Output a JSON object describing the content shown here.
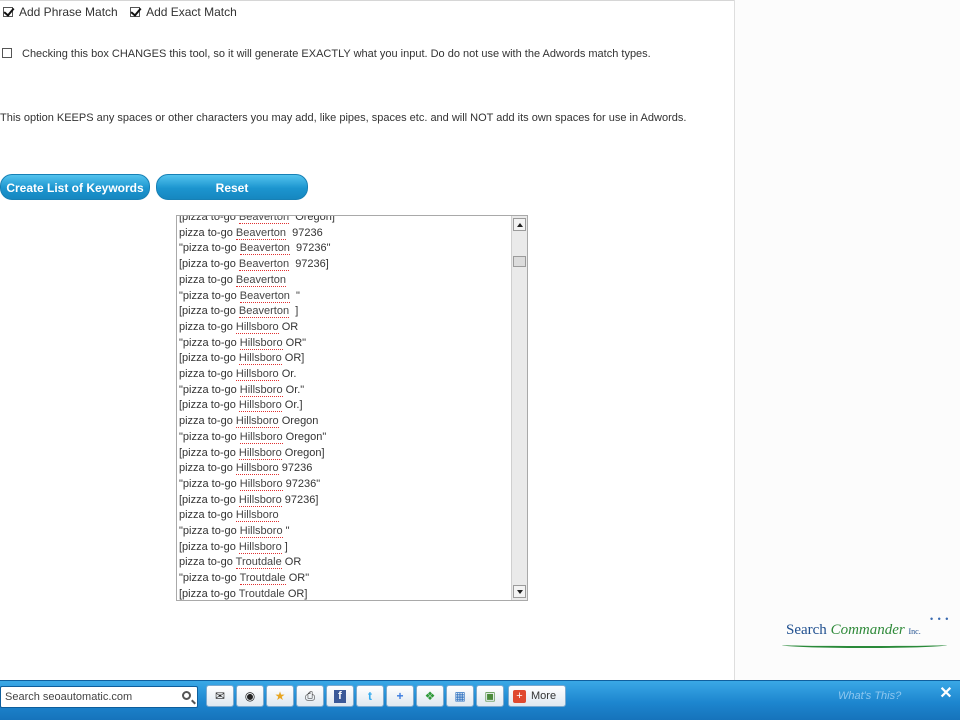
{
  "options": {
    "phrase_label": "Add Phrase Match",
    "phrase_checked": true,
    "exact_label": "Add Exact Match",
    "exact_checked": true
  },
  "exact_option": {
    "checked": false,
    "text": "Checking this box CHANGES this tool, so it will generate EXACTLY what you input. Do do not use with the Adwords match types."
  },
  "keeps_note": "This option KEEPS any spaces or other characters you may add, like pipes, spaces etc. and will NOT add its own spaces for use in Adwords.",
  "buttons": {
    "create": "Create List of Keywords",
    "reset": "Reset"
  },
  "keyword_list": [
    {
      "pre": "[pizza to-go ",
      "kw": "Beaverton",
      "post": "  Oregon]"
    },
    {
      "pre": "pizza to-go ",
      "kw": "Beaverton",
      "post": "  97236"
    },
    {
      "pre": "\"pizza to-go ",
      "kw": "Beaverton",
      "post": "  97236\""
    },
    {
      "pre": "[pizza to-go ",
      "kw": "Beaverton",
      "post": "  97236]"
    },
    {
      "pre": "pizza to-go ",
      "kw": "Beaverton",
      "post": ""
    },
    {
      "pre": "\"pizza to-go ",
      "kw": "Beaverton",
      "post": "  \""
    },
    {
      "pre": "[pizza to-go ",
      "kw": "Beaverton",
      "post": "  ]"
    },
    {
      "pre": "pizza to-go ",
      "kw": "Hillsboro",
      "post": " OR"
    },
    {
      "pre": "\"pizza to-go ",
      "kw": "Hillsboro",
      "post": " OR\""
    },
    {
      "pre": "[pizza to-go ",
      "kw": "Hillsboro",
      "post": " OR]"
    },
    {
      "pre": "pizza to-go ",
      "kw": "Hillsboro",
      "post": " Or."
    },
    {
      "pre": "\"pizza to-go ",
      "kw": "Hillsboro",
      "post": " Or.\""
    },
    {
      "pre": "[pizza to-go ",
      "kw": "Hillsboro",
      "post": " Or.]"
    },
    {
      "pre": "pizza to-go ",
      "kw": "Hillsboro",
      "post": " Oregon"
    },
    {
      "pre": "\"pizza to-go ",
      "kw": "Hillsboro",
      "post": " Oregon\""
    },
    {
      "pre": "[pizza to-go ",
      "kw": "Hillsboro",
      "post": " Oregon]"
    },
    {
      "pre": "pizza to-go ",
      "kw": "Hillsboro",
      "post": " 97236"
    },
    {
      "pre": "\"pizza to-go ",
      "kw": "Hillsboro",
      "post": " 97236\""
    },
    {
      "pre": "[pizza to-go ",
      "kw": "Hillsboro",
      "post": " 97236]"
    },
    {
      "pre": "pizza to-go ",
      "kw": "Hillsboro",
      "post": ""
    },
    {
      "pre": "\"pizza to-go ",
      "kw": "Hillsboro",
      "post": " \""
    },
    {
      "pre": "[pizza to-go ",
      "kw": "Hillsboro",
      "post": " ]"
    },
    {
      "pre": "pizza to-go ",
      "kw": "Troutdale",
      "post": " OR"
    },
    {
      "pre": "\"pizza to-go ",
      "kw": "Troutdale",
      "post": " OR\""
    },
    {
      "pre": "[pizza to-go ",
      "kw": "Troutdale",
      "post": " OR]"
    }
  ],
  "brand": {
    "search": "Search",
    "commander": "Commander",
    "inc": "Inc."
  },
  "toolbar": {
    "search_value": "Search seoautomatic.com",
    "more_label": "More",
    "whats_this": "What's This?",
    "icons": [
      "mail-icon",
      "cursor-icon",
      "star-icon",
      "print-icon",
      "facebook-icon",
      "twitter-icon",
      "google-icon",
      "windows-live-icon",
      "windows-icon",
      "photo-icon"
    ]
  }
}
